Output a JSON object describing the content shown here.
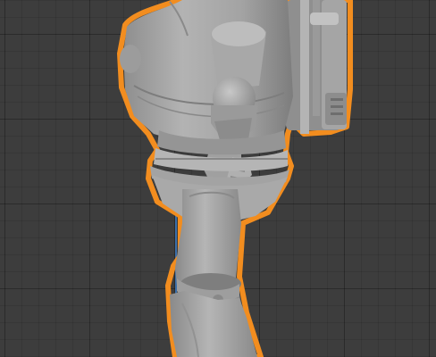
{
  "viewport": {
    "background_color": "#3d3d3d",
    "grid_color": "#333333",
    "selection_outline_color": "#f28d1f",
    "model_base_color": "#a7a7a7",
    "z_axis_color": "#3b6ea8"
  },
  "scene": {
    "selected_object": "robot-figure",
    "view": "3d-viewport-perspective"
  }
}
